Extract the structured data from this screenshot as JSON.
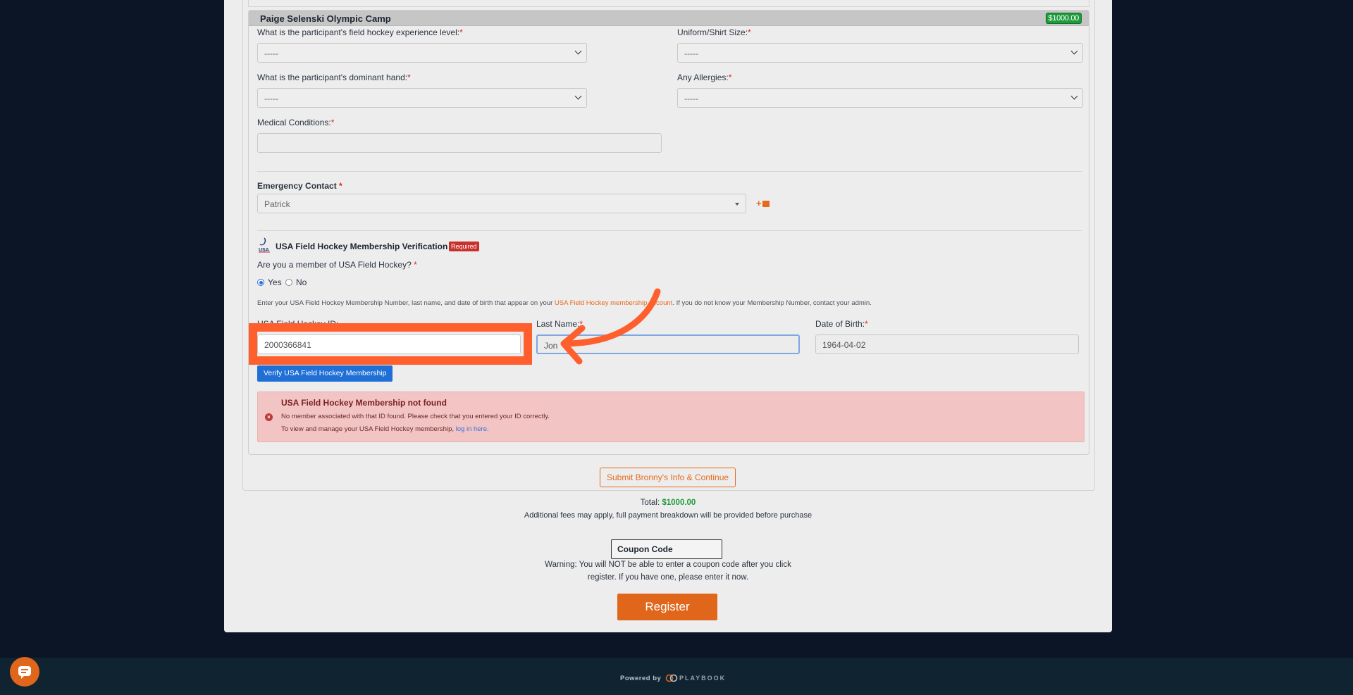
{
  "camp": {
    "title": "Paige Selenski Olympic Camp",
    "price": "$1000.00"
  },
  "form": {
    "experience_label": "What is the participant's field hockey experience level:",
    "experience_value": "-----",
    "shirt_label": "Uniform/Shirt Size:",
    "shirt_value": "-----",
    "hand_label": "What is the participant's dominant hand:",
    "hand_value": "-----",
    "allergies_label": "Any Allergies:",
    "allergies_value": "-----",
    "medical_label": "Medical Conditions:",
    "medical_value": "",
    "required_mark": "*"
  },
  "emergency": {
    "label": "Emergency Contact",
    "value": "Patrick",
    "add_label": "+"
  },
  "usafh": {
    "title": "USA Field Hockey Membership Verification",
    "required_badge": "Required",
    "member_question": "Are you a member of USA Field Hockey?",
    "yes_label": "Yes",
    "no_label": "No",
    "instructions_pre": "Enter your USA Field Hockey Membership Number, last name, and date of birth that appear on your ",
    "instructions_link": "USA Field Hockey membership account",
    "instructions_post": ". If you do not know your Membership Number, contact your admin.",
    "id_label": "USA Field Hockey ID:",
    "id_value": "2000366841",
    "lastname_label": "Last Name:",
    "lastname_value": "Jon",
    "dob_label": "Date of Birth:",
    "dob_value": "1964-04-02",
    "verify_button": "Verify USA Field Hockey Membership"
  },
  "alert": {
    "title": "USA Field Hockey Membership not found",
    "line1": "No member associated with that ID found. Please check that you entered your ID correctly.",
    "line2_pre": "To view and manage your USA Field Hockey membership, ",
    "line2_link": "log in here."
  },
  "actions": {
    "submit_button": "Submit Bronny's Info & Continue",
    "total_label": "Total:",
    "total_value": "$1000.00",
    "fees_note": "Additional fees may apply, full payment breakdown will be provided before purchase",
    "coupon_placeholder": "Coupon Code",
    "warning_line1": "Warning: You will NOT be able to enter a coupon code after you click",
    "warning_line2": "register. If you have one, please enter it now.",
    "register_button": "Register"
  },
  "footer": {
    "powered_by": "Powered by",
    "brand": "PLAYBOOK"
  },
  "colors": {
    "accent": "#e0661b",
    "annotation": "#ff5f2d",
    "success": "#1e9b3a",
    "primary": "#1f6fd6"
  }
}
